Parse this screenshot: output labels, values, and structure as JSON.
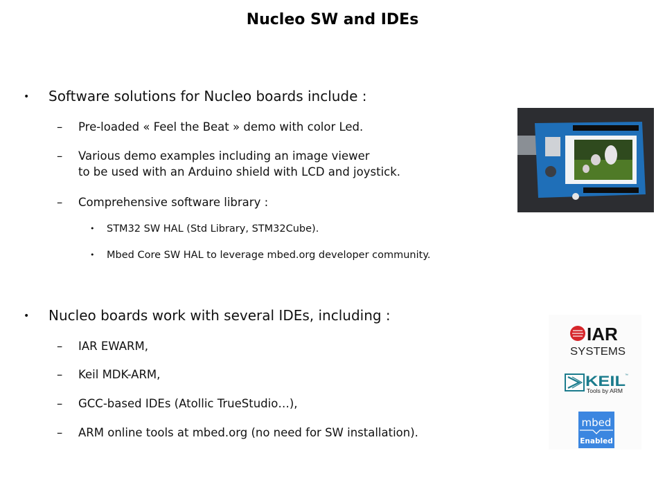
{
  "slide": {
    "title": "Nucleo SW and IDEs",
    "bullet_glyph": "•",
    "dash_glyph": "–",
    "sub_bullet_glyph": "•",
    "sections": [
      {
        "heading": "Software solutions for Nucleo boards include :",
        "items": [
          {
            "text": "Pre-loaded « Feel the Beat » demo with color Led."
          },
          {
            "text": "Various demo examples including an image viewer",
            "text2": "to be used with an Arduino shield with LCD and joystick."
          },
          {
            "text": "Comprehensive software library :",
            "subitems": [
              "STM32 SW HAL (Std Library, STM32Cube).",
              "Mbed Core SW HAL to leverage mbed.org developer community."
            ]
          }
        ]
      },
      {
        "heading": "Nucleo boards work with several IDEs, including :",
        "items": [
          {
            "text": "IAR EWARM,"
          },
          {
            "text": "Keil MDK-ARM,"
          },
          {
            "text": "GCC-based IDEs (Atollic TrueStudio…),"
          },
          {
            "text": "ARM online tools at mbed.org (no need for SW installation)."
          }
        ]
      }
    ]
  },
  "images": {
    "board_photo": "Arduino shield with LCD and joystick",
    "logos": {
      "iar": {
        "line1": "IAR",
        "line2": "SYSTEMS",
        "color": "#d6262b"
      },
      "keil": {
        "line1": "KEIL",
        "line2": "Tools by ARM",
        "tm": "™",
        "color": "#1a7b8c"
      },
      "mbed": {
        "line1": "mbed",
        "line2": "Enabled",
        "color": "#3b86e0"
      }
    }
  }
}
